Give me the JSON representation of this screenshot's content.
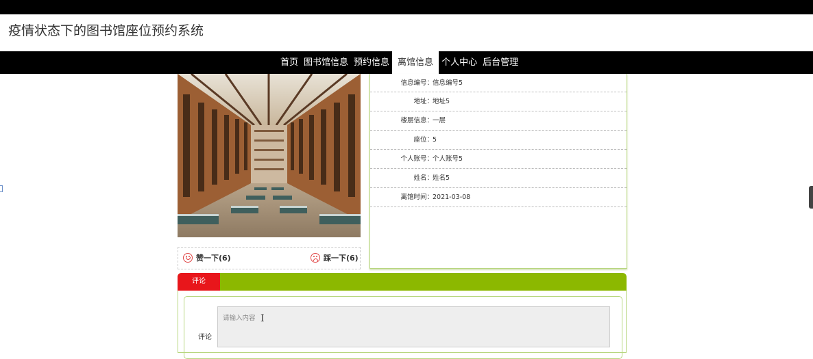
{
  "app": {
    "title": "疫情状态下的图书馆座位预约系统"
  },
  "nav": {
    "items": [
      {
        "label": "首页",
        "active": false
      },
      {
        "label": "图书馆信息",
        "active": false
      },
      {
        "label": "预约信息",
        "active": false
      },
      {
        "label": "离馆信息",
        "active": true
      },
      {
        "label": "个人中心",
        "active": false
      },
      {
        "label": "后台管理",
        "active": false
      }
    ]
  },
  "detail": {
    "fields": [
      {
        "label": "信息编号：",
        "value": "信息编号5"
      },
      {
        "label": "地址：",
        "value": "地址5"
      },
      {
        "label": "楼层信息：",
        "value": "一层"
      },
      {
        "label": "座位：",
        "value": "5"
      },
      {
        "label": "个人账号：",
        "value": "个人账号5"
      },
      {
        "label": "姓名：",
        "value": "姓名5"
      },
      {
        "label": "离馆时间：",
        "value": "2021-03-08"
      }
    ]
  },
  "votes": {
    "like": {
      "label": "赞一下(6)",
      "icon": "smile-icon"
    },
    "dislike": {
      "label": "踩一下(6)",
      "icon": "frown-icon"
    }
  },
  "comments": {
    "tab_label": "评论",
    "field_label": "评论",
    "placeholder": "请输入内容"
  },
  "colors": {
    "accent_green": "#8cb800",
    "tab_red": "#e8161b",
    "nav_bg": "#000000"
  }
}
